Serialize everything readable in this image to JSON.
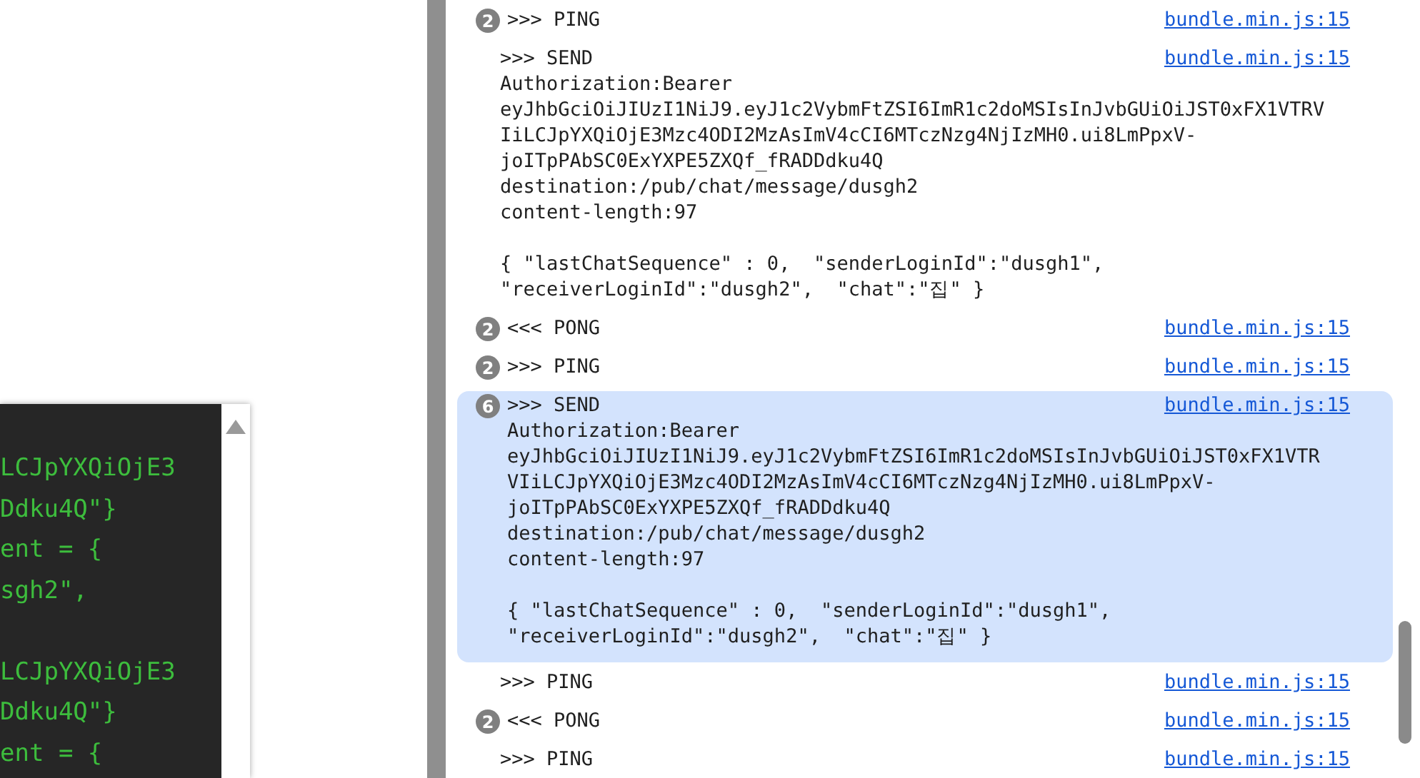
{
  "code_panel": {
    "blocks": [
      [
        "LCJpYXQiOjE3",
        "Ddku4Q\"}",
        "ent = {",
        "sgh2\","
      ],
      [
        "LCJpYXQiOjE3",
        "Ddku4Q\"}",
        "ent = {"
      ]
    ]
  },
  "console": {
    "messages": [
      {
        "count": "2",
        "lines": [
          ">>> PING"
        ],
        "source": "bundle.min.js:15",
        "selected": false
      },
      {
        "lines": [
          ">>> SEND",
          "Authorization:Bearer",
          "eyJhbGciOiJIUzI1NiJ9.eyJ1c2VybmFtZSI6ImR1c2doMSIsInJvbGUiOiJST0xFX1VTRV",
          "IiLCJpYXQiOjE3Mzc4ODI2MzAsImV4cCI6MTczNzg4NjIzMH0.ui8LmPpxV-",
          "joITpPAbSC0ExYXPE5ZXQf_fRADDdku4Q",
          "destination:/pub/chat/message/dusgh2",
          "content-length:97"
        ],
        "body": [
          "{ \"lastChatSequence\" : 0,  \"senderLoginId\":\"dusgh1\",",
          "\"receiverLoginId\":\"dusgh2\",  \"chat\":\"집\" }"
        ],
        "source": "bundle.min.js:15",
        "selected": false
      },
      {
        "count": "2",
        "lines": [
          "<<< PONG"
        ],
        "source": "bundle.min.js:15",
        "selected": false
      },
      {
        "count": "2",
        "lines": [
          ">>> PING"
        ],
        "source": "bundle.min.js:15",
        "selected": false
      },
      {
        "count": "6",
        "lines": [
          ">>> SEND",
          "Authorization:Bearer",
          "eyJhbGciOiJIUzI1NiJ9.eyJ1c2VybmFtZSI6ImR1c2doMSIsInJvbGUiOiJST0xFX1VTR",
          "VIiLCJpYXQiOjE3Mzc4ODI2MzAsImV4cCI6MTczNzg4NjIzMH0.ui8LmPpxV-",
          "joITpPAbSC0ExYXPE5ZXQf_fRADDdku4Q",
          "destination:/pub/chat/message/dusgh2",
          "content-length:97"
        ],
        "body": [
          "{ \"lastChatSequence\" : 0,  \"senderLoginId\":\"dusgh1\",",
          "\"receiverLoginId\":\"dusgh2\",  \"chat\":\"집\" }"
        ],
        "source": "bundle.min.js:15",
        "selected": true
      },
      {
        "lines": [
          ">>> PING"
        ],
        "source": "bundle.min.js:15",
        "selected": false
      },
      {
        "count": "2",
        "lines": [
          "<<< PONG"
        ],
        "source": "bundle.min.js:15",
        "selected": false
      },
      {
        "lines": [
          ">>> PING"
        ],
        "source": "bundle.min.js:15",
        "selected": false
      }
    ]
  }
}
